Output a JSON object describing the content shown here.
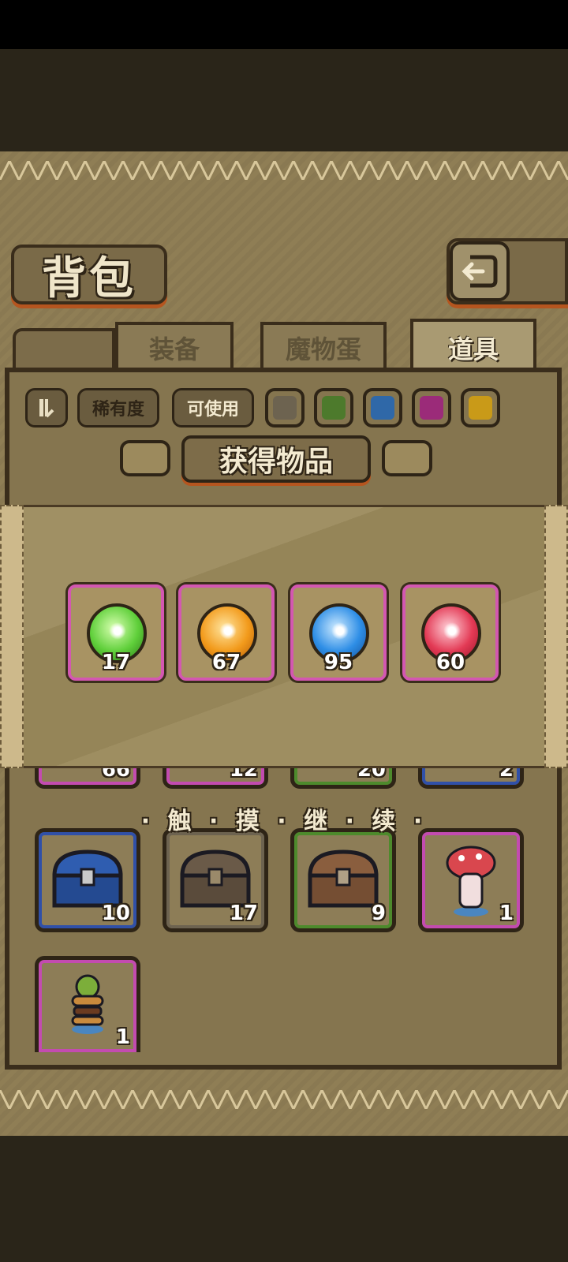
{
  "header": {
    "title": "背包"
  },
  "tabs": [
    {
      "label": "装备",
      "active": false
    },
    {
      "label": "魔物蛋",
      "active": false
    },
    {
      "label": "道具",
      "active": true
    }
  ],
  "filters": {
    "sort_icon": "sort-toggle-icon",
    "rarity_label": "稀有度",
    "usable_label": "可使用",
    "colors": [
      "#6d6350",
      "#4d7a2c",
      "#2f68a8",
      "#9b2b79",
      "#c99a18"
    ]
  },
  "inventory": {
    "row1_partial_counts": [
      "66",
      "12",
      "20",
      "2"
    ],
    "row1_colors": [
      "#c34bb0",
      "#c34bb0",
      "#4d8a2c",
      "#3050a8"
    ],
    "row2": [
      {
        "icon": "blue-chest-icon",
        "count": "10",
        "color": "#3050a8"
      },
      {
        "icon": "wooden-chest-icon",
        "count": "17",
        "color": "#6d6350"
      },
      {
        "icon": "brown-chest-icon",
        "count": "9",
        "color": "#4d8a2c"
      },
      {
        "icon": "mushroom-figure-icon",
        "count": "1",
        "color": "#c34bb0"
      }
    ],
    "row3": [
      {
        "icon": "burger-figure-icon",
        "count": "1",
        "color": "#c34bb0"
      }
    ]
  },
  "reward_modal": {
    "title": "获得物品",
    "items": [
      {
        "icon": "green-orb-icon",
        "qty": "17",
        "color": "#5fcf3a"
      },
      {
        "icon": "orange-orb-icon",
        "qty": "67",
        "color": "#f29a1b"
      },
      {
        "icon": "blue-orb-icon",
        "qty": "95",
        "color": "#2e8ee6"
      },
      {
        "icon": "red-orb-icon",
        "qty": "60",
        "color": "#e33a55"
      }
    ],
    "continue_hint": "· 触 · 摸 · 继 · 续 ·"
  }
}
